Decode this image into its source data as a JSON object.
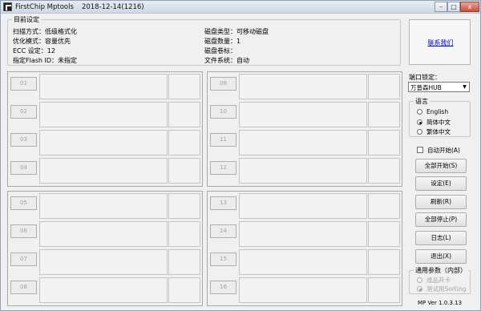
{
  "window": {
    "title": "FirstChip Mptools",
    "version_date": "2018-12-14(1216)"
  },
  "caption_buttons": {
    "minimize": "–",
    "maximize": "□",
    "close": "x"
  },
  "current_settings": {
    "title": "目前设定",
    "scan_mode": "扫描方式：低级格式化",
    "optimize_mode": "优化模式：容量优先",
    "ecc": "ECC 设定：12",
    "flash_id": "指定Flash ID：未指定",
    "disk_type": "磁盘类型：可移动磁盘",
    "disk_count": "磁盘数量：1",
    "disk_label": "磁盘卷标：",
    "file_system": "文件系统：自动"
  },
  "contact_link": "联系我们",
  "ports": {
    "panel1": [
      "01",
      "02",
      "03",
      "04"
    ],
    "panel2": [
      "09",
      "10",
      "11",
      "12"
    ],
    "panel3": [
      "05",
      "06",
      "07",
      "08"
    ],
    "panel4": [
      "13",
      "14",
      "15",
      "16"
    ]
  },
  "port_lock": {
    "label": "端口锁定：",
    "selected": "万普森HUB"
  },
  "language": {
    "title": "语言",
    "options": [
      {
        "label": "English",
        "selected": false
      },
      {
        "label": "简体中文",
        "selected": true
      },
      {
        "label": "繁体中文",
        "selected": false
      }
    ]
  },
  "auto_start": {
    "label": "自动开始(A)",
    "checked": false
  },
  "buttons": {
    "start_all": "全部开始(S)",
    "settings": "设定(E)",
    "refresh": "刷新(R)",
    "stop_all": "全部停止(P)",
    "log": "日志(L)",
    "exit": "退出(X)"
  },
  "general_params": {
    "title": "通用参数（内部）",
    "options": [
      {
        "label": "成品开卡",
        "selected": false
      },
      {
        "label": "测试用Sorting",
        "selected": true
      }
    ]
  },
  "footer": {
    "version": "MP Ver 1.0.3.13"
  }
}
